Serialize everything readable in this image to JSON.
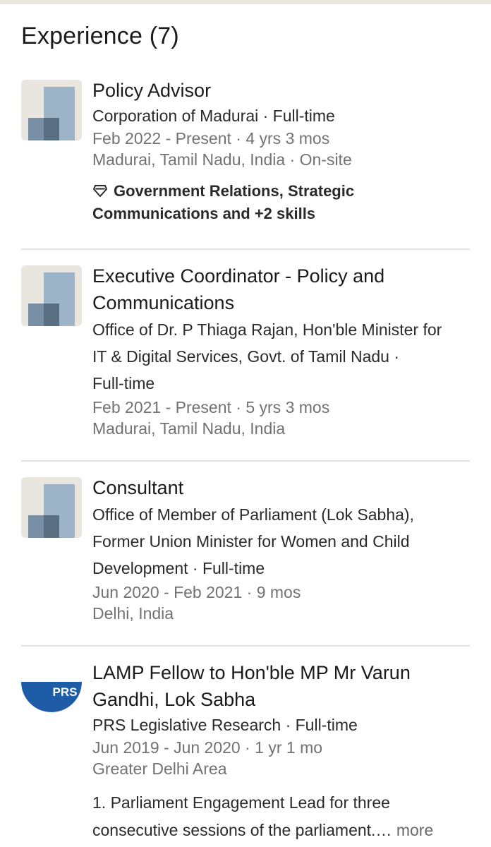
{
  "section": {
    "title": "Experience (7)"
  },
  "experiences": [
    {
      "title": "Policy Advisor",
      "company": "Corporation of Madurai · Full-time",
      "dates": "Feb 2022 - Present · 4 yrs 3 mos",
      "location": "Madurai, Tamil Nadu, India · On-site",
      "skills_line1": "Government Relations, Strategic",
      "skills_line2": "Communications and +2 skills",
      "logo_icon": "company-logo-placeholder"
    },
    {
      "title_line1": "Executive Coordinator - Policy and",
      "title_line2": "Communications",
      "company_line1": "Office of Dr. P Thiaga Rajan, Hon'ble Minister for",
      "company_line2": "IT & Digital Services, Govt. of Tamil Nadu ·",
      "company_line3": "Full-time",
      "dates": "Feb 2021 - Present · 5 yrs 3 mos",
      "location": "Madurai, Tamil Nadu, India",
      "logo_icon": "company-logo-placeholder"
    },
    {
      "title": "Consultant",
      "company_line1": "Office of Member of Parliament (Lok Sabha),",
      "company_line2": "Former Union Minister for Women and Child",
      "company_line3": "Development · Full-time",
      "dates": "Jun 2020 - Feb 2021 · 9 mos",
      "location": "Delhi, India",
      "logo_icon": "company-logo-placeholder"
    },
    {
      "title_line1": "LAMP Fellow to Hon'ble MP Mr Varun",
      "title_line2": "Gandhi, Lok Sabha",
      "company": "PRS Legislative Research · Full-time",
      "dates": "Jun 2019 - Jun 2020 · 1 yr 1 mo",
      "location": "Greater Delhi Area",
      "desc_line1": "1. Parliament Engagement Lead for three",
      "desc_line2": "consecutive sessions of the parliament.…",
      "more_label": "more",
      "logo_text": "PRS",
      "logo_color": "#1f5ca8"
    }
  ],
  "colors": {
    "background": "#ffffff",
    "title_text": "#1b1b1b",
    "meta_text": "#727272",
    "divider": "#e2e2e2",
    "logo_bg": "#e9e5df",
    "logo_light": "#9db3c8",
    "logo_dark": "#5b6f83"
  }
}
